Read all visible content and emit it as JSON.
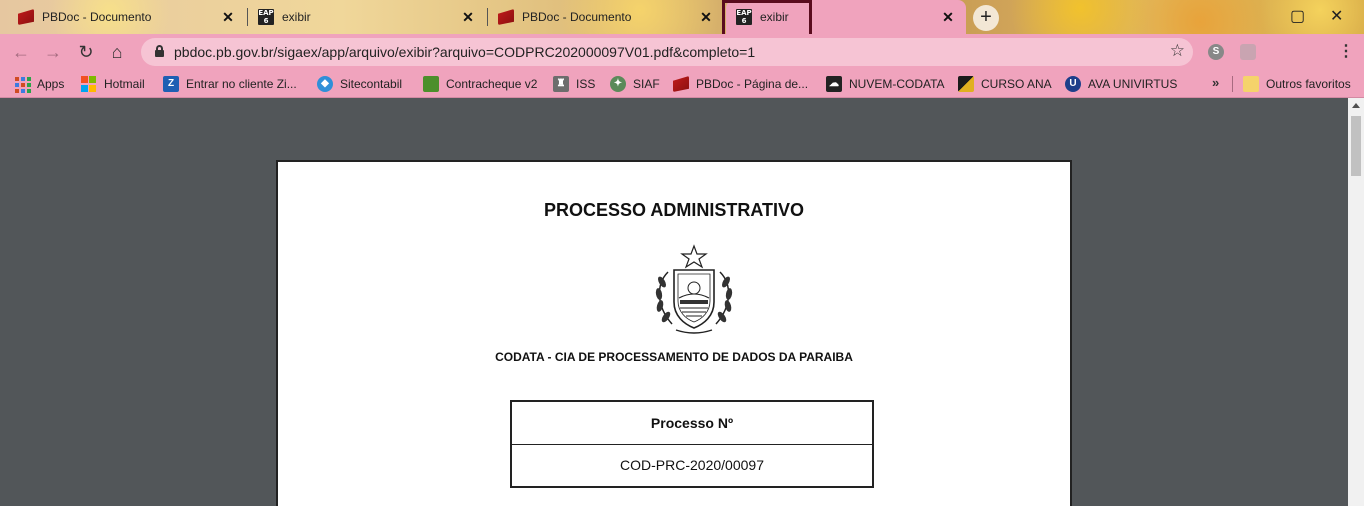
{
  "tabs": [
    {
      "title": "PBDoc - Documento",
      "icon": "pbdoc-icon",
      "active": false
    },
    {
      "title": "exibir",
      "icon": "eap-icon",
      "active": false
    },
    {
      "title": "PBDoc - Documento",
      "icon": "pbdoc-icon",
      "active": false
    },
    {
      "title": "exibir",
      "icon": "eap-icon",
      "active": true
    }
  ],
  "tab_favicon_text": {
    "eap_top": "EAP",
    "eap_num": "6"
  },
  "tab_close_glyph": "✕",
  "new_tab_glyph": "+",
  "address_bar": {
    "url": "pbdoc.pb.gov.br/sigaex/app/arquivo/exibir?arquivo=CODPRC202000097V01.pdf&completo=1"
  },
  "bookmarks": [
    {
      "label": "Apps",
      "icon": "apps-grid-icon"
    },
    {
      "label": "Hotmail",
      "icon": "microsoft-icon"
    },
    {
      "label": "Entrar no cliente Zi...",
      "icon": "zimbra-icon",
      "glyph": "Z"
    },
    {
      "label": "Sitecontabil",
      "icon": "sitecontabil-icon"
    },
    {
      "label": "Contracheque v2",
      "icon": "contracheque-icon"
    },
    {
      "label": "ISS",
      "icon": "iss-icon"
    },
    {
      "label": "SIAF",
      "icon": "siaf-icon"
    },
    {
      "label": "PBDoc - Página de...",
      "icon": "pbdoc-icon"
    },
    {
      "label": "NUVEM-CODATA",
      "icon": "cloud-icon"
    },
    {
      "label": "CURSO ANA",
      "icon": "ana-icon"
    },
    {
      "label": "AVA UNIVIRTUS",
      "icon": "univirtus-icon",
      "glyph": "U"
    },
    {
      "label": "Outros favoritos",
      "icon": "folder-icon"
    }
  ],
  "bookmarks_overflow": "»",
  "document": {
    "title": "PROCESSO ADMINISTRATIVO",
    "organization": "CODATA - CIA DE PROCESSAMENTO DE DADOS DA PARAIBA",
    "table": {
      "header": "Processo Nº",
      "value": "COD-PRC-2020/00097"
    }
  },
  "colors": {
    "chrome_pink": "#f0a3bd",
    "omnibox": "#f6c4d4",
    "viewer_bg": "#525659",
    "highlight_border": "#5a0c1e"
  }
}
